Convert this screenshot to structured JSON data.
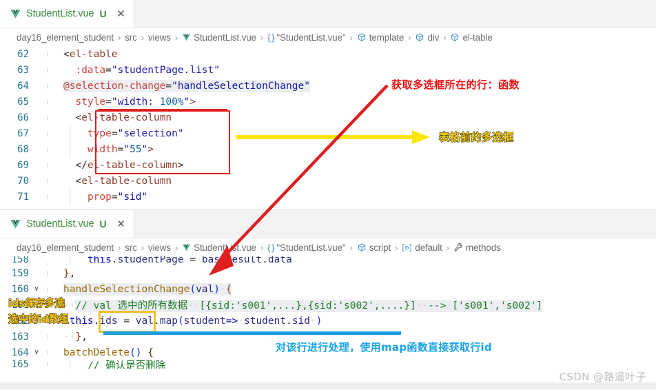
{
  "editor": {
    "panes": [
      {
        "id": "top",
        "tab": {
          "label": "StudentList.vue",
          "dirty_marker": "U",
          "close_glyph": "✕",
          "icon": "vue-logo-icon"
        },
        "breadcrumb": [
          {
            "text": "day16_element_student",
            "icon": ""
          },
          {
            "text": "src",
            "icon": ""
          },
          {
            "text": "views",
            "icon": ""
          },
          {
            "text": "StudentList.vue",
            "icon": "vue-logo-icon"
          },
          {
            "text": "\"StudentList.vue\"",
            "icon": "braces-icon"
          },
          {
            "text": "template",
            "icon": "cube-icon"
          },
          {
            "text": "div",
            "icon": "cube-icon"
          },
          {
            "text": "el-table",
            "icon": "cube-icon"
          }
        ],
        "lines": [
          {
            "no": "62",
            "fold": "",
            "code": "<el-table"
          },
          {
            "no": "63",
            "fold": "",
            "code": "  :data=\"studentPage.list\""
          },
          {
            "no": "64",
            "fold": "",
            "code": "  @selection-change=\"handleSelectionChange\""
          },
          {
            "no": "65",
            "fold": "",
            "code": "  style=\"width: 100%\">"
          },
          {
            "no": "66",
            "fold": "",
            "code": "  <el-table-column"
          },
          {
            "no": "67",
            "fold": "",
            "code": "    type=\"selection\""
          },
          {
            "no": "68",
            "fold": "",
            "code": "    width=\"55\">"
          },
          {
            "no": "69",
            "fold": "",
            "code": "  </el-table-column>"
          },
          {
            "no": "70",
            "fold": "",
            "code": "  <el-table-column"
          },
          {
            "no": "71",
            "fold": "",
            "code": "    prop=\"sid\""
          }
        ]
      },
      {
        "id": "bottom",
        "tab": {
          "label": "StudentList.vue",
          "dirty_marker": "U",
          "close_glyph": "✕",
          "icon": "vue-logo-icon"
        },
        "breadcrumb": [
          {
            "text": "day16_element_student",
            "icon": ""
          },
          {
            "text": "src",
            "icon": ""
          },
          {
            "text": "views",
            "icon": ""
          },
          {
            "text": "StudentList.vue",
            "icon": "vue-logo-icon"
          },
          {
            "text": "\"StudentList.vue\"",
            "icon": "braces-icon"
          },
          {
            "text": "script",
            "icon": "cube-icon"
          },
          {
            "text": "default",
            "icon": "export-default-icon"
          },
          {
            "text": "methods",
            "icon": "wrench-icon"
          }
        ],
        "lines": [
          {
            "no": "158",
            "fold": "",
            "code": "    this.studentPage = baseResult.data"
          },
          {
            "no": "159",
            "fold": "",
            "code": "  },"
          },
          {
            "no": "160",
            "fold": "∨",
            "code": "  handleSelectionChange(val) {"
          },
          {
            "no": "161",
            "fold": "",
            "code": "    // val 选中的所有数据  [{sid:'s001',...},{sid:'s002',....}]  --> ['s001','s002']"
          },
          {
            "no": "162",
            "fold": "",
            "code": "    this.ids = val.map(student=> student.sid )"
          },
          {
            "no": "163",
            "fold": "",
            "code": "  },"
          },
          {
            "no": "164",
            "fold": "∨",
            "code": "  batchDelete() {"
          },
          {
            "no": "165",
            "fold": "",
            "code": "    // 确认是否删除"
          }
        ]
      }
    ]
  },
  "annotations": {
    "red_note_1": "获取多选框所在的行：函数",
    "yellow_note_1": "表格前的多选框",
    "yellow_note_2_line1": "ids保存多选",
    "yellow_note_2_line2": "选中的id数组",
    "blue_note_1": "对该行进行处理，使用map函数直接获取行id",
    "colors": {
      "red": "#e02020",
      "yellow": "#f5d020",
      "blue": "#19a3e8",
      "gold_box": "#f0c030"
    }
  },
  "watermark": {
    "text": "CSDN @路遥叶子"
  }
}
